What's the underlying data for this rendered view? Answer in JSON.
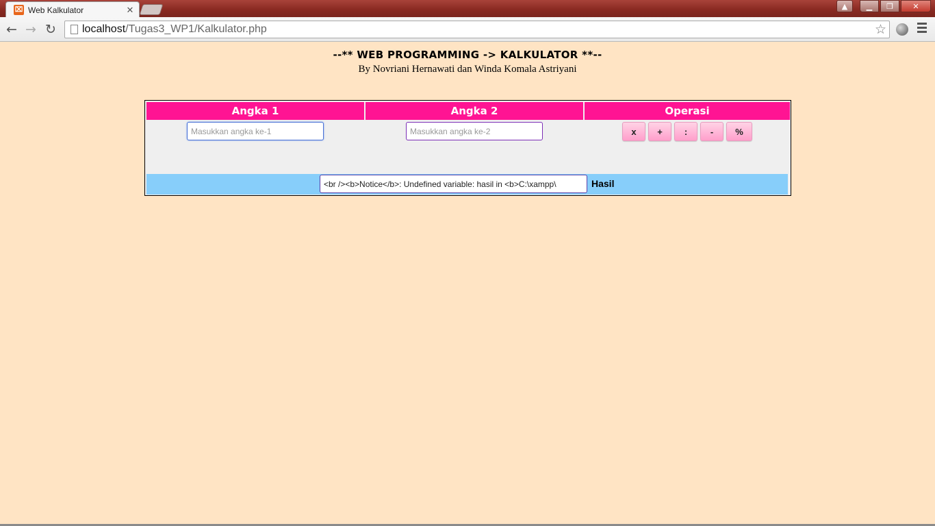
{
  "browser": {
    "tab_title": "Web Kalkulator",
    "url_host": "localhost",
    "url_path": "/Tugas3_WP1/Kalkulator.php"
  },
  "page": {
    "title": "--** WEB PROGRAMMING -> KALKULATOR **--",
    "subtitle": "By Novriani Hernawati dan Winda Komala Astriyani"
  },
  "calculator": {
    "headers": [
      "Angka 1",
      "Angka 2",
      "Operasi"
    ],
    "input1_placeholder": "Masukkan angka ke-1",
    "input2_placeholder": "Masukkan angka ke-2",
    "operations": [
      "x",
      "+",
      ":",
      "-",
      "%"
    ],
    "result_value": "<br /><b>Notice</b>:  Undefined variable: hasil in <b>C:\\xampp\\",
    "result_label": "Hasil"
  },
  "colors": {
    "page_background": "#ffe4c4",
    "header_background": "#ff1493",
    "result_row_background": "#87cefa"
  }
}
